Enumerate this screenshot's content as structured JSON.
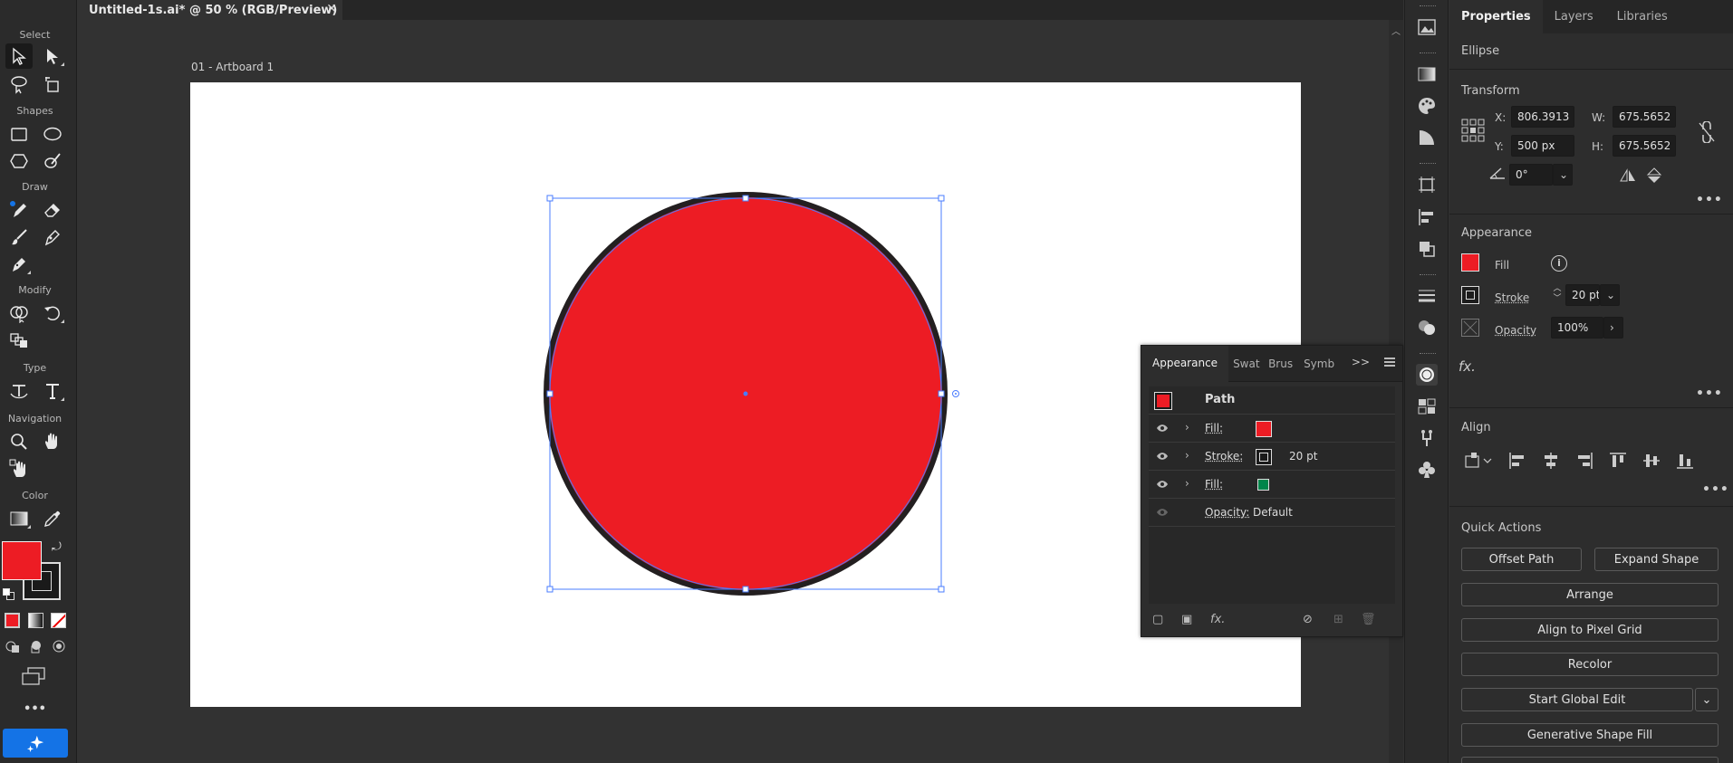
{
  "document": {
    "tab_title": "Untitled-1s.ai* @ 50 % (RGB/Preview)",
    "artboard_label": "01 - Artboard 1"
  },
  "colors": {
    "fill": "#ed1c24",
    "stroke": "#231f20",
    "selection": "#4a7cff",
    "second_fill": "#00854a",
    "accent_blue": "#1473e6"
  },
  "toolbar": {
    "sections": {
      "select": "Select",
      "shapes": "Shapes",
      "draw": "Draw",
      "modify": "Modify",
      "type": "Type",
      "navigation": "Navigation",
      "color": "Color"
    },
    "more": "•••"
  },
  "appearance_panel": {
    "tabs": [
      "Appearance",
      "Swat",
      "Brus",
      "Symb"
    ],
    "more": ">>",
    "object_label": "Path",
    "rows": [
      {
        "label": "Fill:",
        "value": ""
      },
      {
        "label": "Stroke:",
        "value": "20 pt"
      },
      {
        "label": "Fill:",
        "value": ""
      },
      {
        "label": "Opacity:",
        "value": "Default"
      }
    ],
    "fx": "fx."
  },
  "properties": {
    "tabs": [
      "Properties",
      "Layers",
      "Libraries"
    ],
    "object_type": "Ellipse",
    "transform": {
      "heading": "Transform",
      "x_label": "X:",
      "x_value": "806.3913 px",
      "y_label": "Y:",
      "y_value": "500 px",
      "w_label": "W:",
      "w_value": "675.5652 px",
      "h_label": "H:",
      "h_value": "675.5652 px",
      "angle_value": "0°"
    },
    "appearance": {
      "heading": "Appearance",
      "fill_label": "Fill",
      "stroke_label": "Stroke",
      "stroke_value": "20 pt",
      "opacity_label": "Opacity",
      "opacity_value": "100%",
      "fx": "fx."
    },
    "align": {
      "heading": "Align"
    },
    "quick_actions": {
      "heading": "Quick Actions",
      "offset_path": "Offset Path",
      "expand_shape": "Expand Shape",
      "arrange": "Arrange",
      "align_pixel_grid": "Align to Pixel Grid",
      "recolor": "Recolor",
      "start_global_edit": "Start Global Edit",
      "generative_shape_fill": "Generative Shape Fill"
    },
    "more": "•••"
  }
}
